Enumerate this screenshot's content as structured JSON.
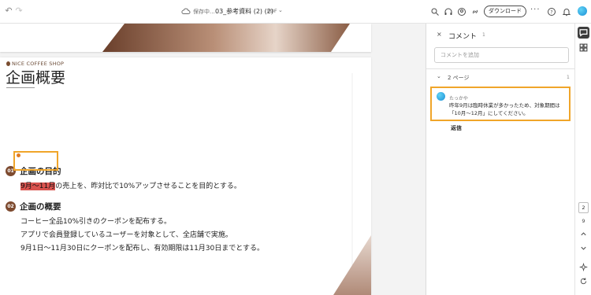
{
  "toolbar": {
    "save_status": "保存中...",
    "document_title": "03_参考資料 (2) (2)",
    "document_type": "PDF",
    "download_label": "ダウンロード",
    "more_label": "···"
  },
  "document": {
    "brand": "NICE COFFEE SHOP",
    "title": "企画概要",
    "sections": [
      {
        "number": "01",
        "heading": "企画の目的",
        "highlighted": "9月～11月",
        "lines_rest": "の売上を、昨対比で10%アップさせることを目的とする。"
      },
      {
        "number": "02",
        "heading": "企画の概要",
        "lines": [
          "コーヒー全品10%引きのクーポンを配布する。",
          "アプリで会員登録しているユーザーを対象として、全店舗で実施。",
          "9月1日～11月30日にクーポンを配布し、有効期限は11月30日までとする。"
        ]
      }
    ]
  },
  "comments_panel": {
    "close_label": "×",
    "title": "コメント",
    "count": "1",
    "add_placeholder": "コメントを追加",
    "page_group_label": "2 ページ",
    "page_group_count": "1",
    "comment": {
      "author": "たっかや",
      "text": "昨年9月は臨時休業が多かったため、対象期間は「10月～12月」にしてください。"
    },
    "reply_label": "返信"
  },
  "rail": {
    "current_page": "2",
    "total_pages": "9"
  },
  "colors": {
    "highlight": "#d9534f",
    "focus_outline": "#f0a52a",
    "badge_brown": "#7d4a2f"
  }
}
